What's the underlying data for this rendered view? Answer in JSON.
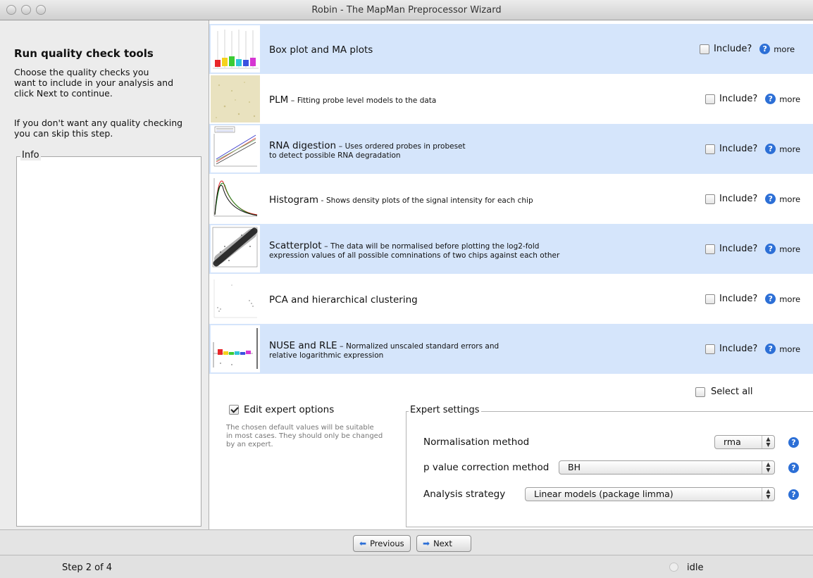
{
  "window": {
    "title": "Robin - The MapMan Preprocessor Wizard"
  },
  "left": {
    "title": "Run quality check tools",
    "paragraph1": "Choose the quality checks you\nwant to include in your analysis and\nclick Next to continue.",
    "paragraph2": "If you don't want any quality checking\nyou can skip this step.",
    "info_label": "Info"
  },
  "qc_items": [
    {
      "name": "Box plot and MA plots",
      "sep": "",
      "desc": "",
      "desc2": "",
      "include_label": "Include?",
      "more_label": "more",
      "checked": false
    },
    {
      "name": "PLM",
      "sep": " – ",
      "desc": "Fitting probe level models to the data",
      "desc2": "",
      "include_label": "Include?",
      "more_label": "more",
      "checked": false
    },
    {
      "name": "RNA digestion",
      "sep": " – ",
      "desc": "Uses ordered probes in probeset",
      "desc2": "to detect possible RNA degradation",
      "include_label": "Include?",
      "more_label": "more",
      "checked": false
    },
    {
      "name": "Histogram",
      "sep": " - ",
      "desc": "Shows density plots of the signal intensity for each chip",
      "desc2": "",
      "include_label": "Include?",
      "more_label": "more",
      "checked": false
    },
    {
      "name": "Scatterplot",
      "sep": " – ",
      "desc": "The data will be normalised before plotting the log2-fold",
      "desc2": "expression values of all possible comninations of two chips against each other",
      "include_label": "Include?",
      "more_label": "more",
      "checked": false
    },
    {
      "name": "PCA and hierarchical clustering",
      "sep": "",
      "desc": "",
      "desc2": "",
      "include_label": "Include?",
      "more_label": "more",
      "checked": false
    },
    {
      "name": "NUSE and RLE",
      "sep": " – ",
      "desc": "Normalized unscaled standard errors and",
      "desc2": "relative logarithmic expression",
      "include_label": "Include?",
      "more_label": "more",
      "checked": false
    }
  ],
  "select_all": {
    "label": "Select all",
    "checked": false
  },
  "expert": {
    "edit_label": "Edit expert options",
    "edit_checked": true,
    "note": "The chosen default values will be suitable\nin most cases. They should only be changed\nby an expert.",
    "settings_label": "Expert settings",
    "normalisation": {
      "label": "Normalisation method",
      "value": "rma"
    },
    "pvalue": {
      "label": "p value correction method",
      "value": "BH"
    },
    "strategy": {
      "label": "Analysis strategy",
      "value": "Linear models (package limma)"
    }
  },
  "nav": {
    "previous_label": "Previous",
    "next_label": "Next"
  },
  "status": {
    "step": "Step 2 of 4",
    "state": "idle"
  },
  "colors": {
    "row_highlight": "#d5e5fb",
    "help_blue": "#2c6fd6"
  }
}
